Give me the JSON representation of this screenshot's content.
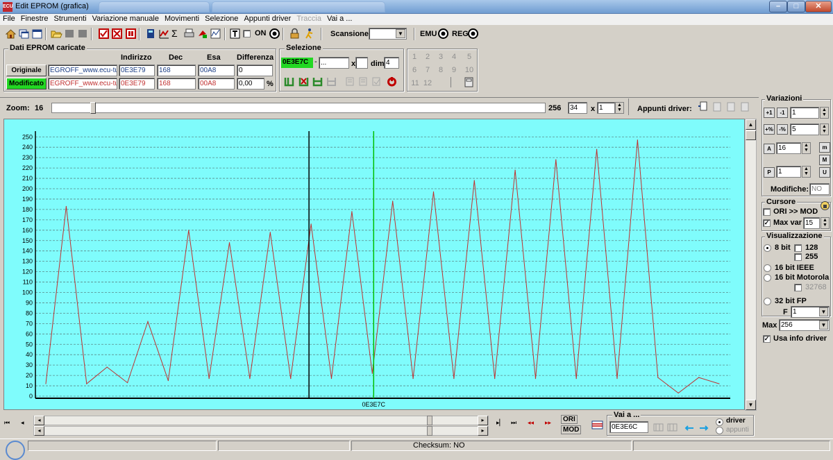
{
  "window": {
    "title": "Edit EPROM (grafica)",
    "app_icon": "ECU"
  },
  "menu": [
    "File",
    "Finestre",
    "Strumenti",
    "Variazione manuale",
    "Movimenti",
    "Selezione",
    "Appunti driver",
    "Traccia",
    "Vai a ..."
  ],
  "menu_disabled": [
    "Traccia"
  ],
  "toolbar": {
    "on_label": "ON",
    "scansione_label": "Scansione",
    "emu_label": "EMU",
    "reg_label": "REG"
  },
  "dati": {
    "group_label": "Dati EPROM caricate",
    "headers": {
      "indirizzo": "Indirizzo",
      "dec": "Dec",
      "esa": "Esa",
      "differenza": "Differenza"
    },
    "originale": {
      "label": "Originale",
      "file": "EGROFF_www.ecu-tu",
      "indirizzo": "0E3E79",
      "dec": "168",
      "esa": "00A8",
      "differenza": "0"
    },
    "modificato": {
      "label": "Modificato",
      "file": "EGROFF_www.ecu-tu",
      "indirizzo": "0E3E79",
      "dec": "168",
      "esa": "00A8",
      "differenza": "0,00",
      "unit": "%"
    }
  },
  "selezione": {
    "group_label": "Selezione",
    "start": "0E3E7C",
    "dash": "-",
    "end": "...",
    "x_label": "x",
    "dim_label": "dim.",
    "dim_value": "4"
  },
  "number_grid": [
    "1",
    "2",
    "3",
    "4",
    "5",
    "6",
    "7",
    "8",
    "9",
    "10",
    "11",
    "12"
  ],
  "zoom": {
    "label": "Zoom:",
    "min": "16",
    "max": "256",
    "value": "34",
    "x_label": "x",
    "mult": "1",
    "slider_fraction": 0.078
  },
  "appunti": {
    "label": "Appunti driver:"
  },
  "chart_data": {
    "type": "line",
    "x_label_bottom": "0E3E7C",
    "ylim": [
      0,
      255
    ],
    "yticks": [
      0,
      10,
      20,
      30,
      40,
      50,
      60,
      70,
      80,
      90,
      100,
      110,
      120,
      130,
      140,
      150,
      160,
      170,
      180,
      190,
      200,
      210,
      220,
      230,
      240,
      250
    ],
    "grid": true,
    "series": [
      {
        "color": "#c0302f",
        "values": [
          12,
          183,
          12,
          28,
          13,
          72,
          15,
          160,
          17,
          148,
          17,
          158,
          17,
          166,
          17,
          178,
          22,
          188,
          17,
          197,
          17,
          208,
          17,
          218,
          17,
          228,
          17,
          238,
          17,
          247,
          18,
          3,
          18,
          12
        ]
      }
    ],
    "cursor_black_index": 13,
    "cursor_green_index": 16,
    "cursor_black_color": "#000000",
    "cursor_green_color": "#00c000"
  },
  "variazioni": {
    "group_label": "Variazioni",
    "v1": "1",
    "v2": "5",
    "v3": "16",
    "v4": "1",
    "modifiche_label": "Modifiche:",
    "modifiche_value": "NO"
  },
  "cursore": {
    "group_label": "Cursore",
    "ori_mod": "ORI >> MOD",
    "max_var_label": "Max var",
    "max_var_value": "15"
  },
  "visualizzazione": {
    "group_label": "Visualizzazione",
    "bit8": "8 bit",
    "opt128": "128",
    "opt255": "255",
    "bit16ieee": "16 bit IEEE",
    "bit16moto": "16 bit Motorola",
    "opt32768": "32768",
    "bit32fp": "32 bit FP",
    "f_label": "F",
    "f_value": "1",
    "max_label": "Max",
    "max_value": "256",
    "usa_info": "Usa info driver"
  },
  "bottom": {
    "ori_label": "ORI",
    "mod_label": "MOD",
    "vai_label": "Vai a ...",
    "vai_value": "0E3E6C",
    "driver_label": "driver",
    "appunti_label": "appunti"
  },
  "status": {
    "checksum": "Checksum: NO"
  }
}
